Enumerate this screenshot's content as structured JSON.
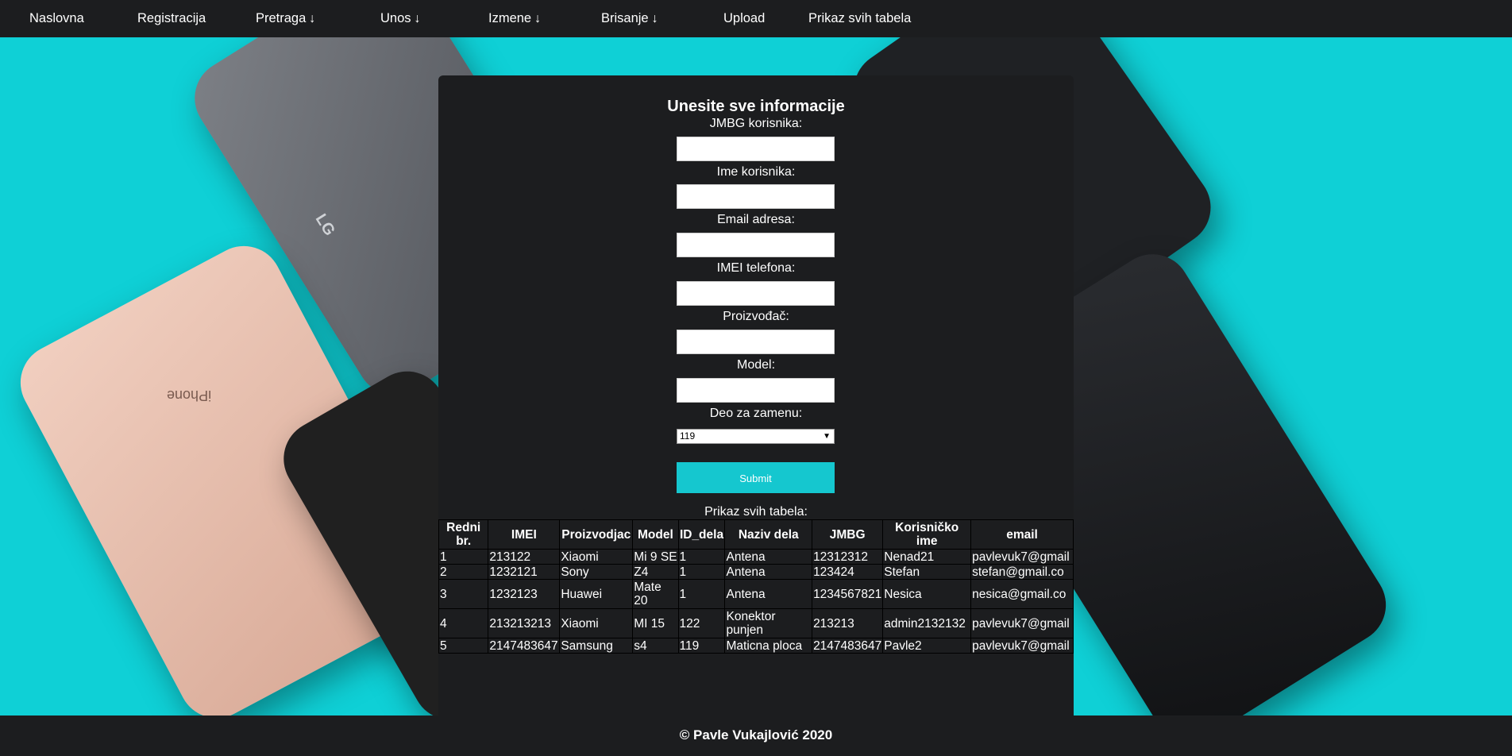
{
  "nav": {
    "items": [
      {
        "label": "Naslovna",
        "arrow": ""
      },
      {
        "label": "Registracija",
        "arrow": ""
      },
      {
        "label": "Pretraga",
        "arrow": "↓"
      },
      {
        "label": "Unos",
        "arrow": "↓"
      },
      {
        "label": "Izmene",
        "arrow": "↓"
      },
      {
        "label": "Brisanje",
        "arrow": "↓"
      },
      {
        "label": "Upload",
        "arrow": ""
      },
      {
        "label": "Prikaz svih tabela",
        "arrow": ""
      }
    ]
  },
  "background": {
    "lg_logo": "LG",
    "iphone_text": "iPhone"
  },
  "form": {
    "title": "Unesite sve informacije",
    "fields": [
      {
        "label": "JMBG korisnika:",
        "value": ""
      },
      {
        "label": "Ime korisnika:",
        "value": ""
      },
      {
        "label": "Email adresa:",
        "value": ""
      },
      {
        "label": "IMEI telefona:",
        "value": ""
      },
      {
        "label": "Proizvođač:",
        "value": ""
      },
      {
        "label": "Model:",
        "value": ""
      }
    ],
    "select_label": "Deo za zamenu:",
    "select_value": "119",
    "submit_label": "Submit"
  },
  "table": {
    "caption": "Prikaz svih tabela:",
    "headers": [
      "Redni br.",
      "IMEI",
      "Proizvodjac",
      "Model",
      "ID_dela",
      "Naziv dela",
      "JMBG",
      "Korisničko ime",
      "email"
    ],
    "rows": [
      [
        "1",
        "213122",
        "Xiaomi",
        "Mi 9 SE",
        "1",
        "Antena",
        "12312312",
        "Nenad21",
        "pavlevuk7@gmail"
      ],
      [
        "2",
        "1232121",
        "Sony",
        "Z4",
        "1",
        "Antena",
        "123424",
        "Stefan",
        "stefan@gmail.co"
      ],
      [
        "3",
        "1232123",
        "Huawei",
        "Mate 20",
        "1",
        "Antena",
        "1234567821",
        "Nesica",
        "nesica@gmail.co"
      ],
      [
        "4",
        "213213213",
        "Xiaomi",
        "MI 15",
        "122",
        "Konektor punjen",
        "213213",
        "admin2132132",
        "pavlevuk7@gmail"
      ],
      [
        "5",
        "2147483647",
        "Samsung",
        "s4",
        "119",
        "Maticna ploca",
        "2147483647",
        "Pavle2",
        "pavlevuk7@gmail"
      ]
    ]
  },
  "footer": {
    "text": "© Pavle Vukajlović 2020"
  }
}
